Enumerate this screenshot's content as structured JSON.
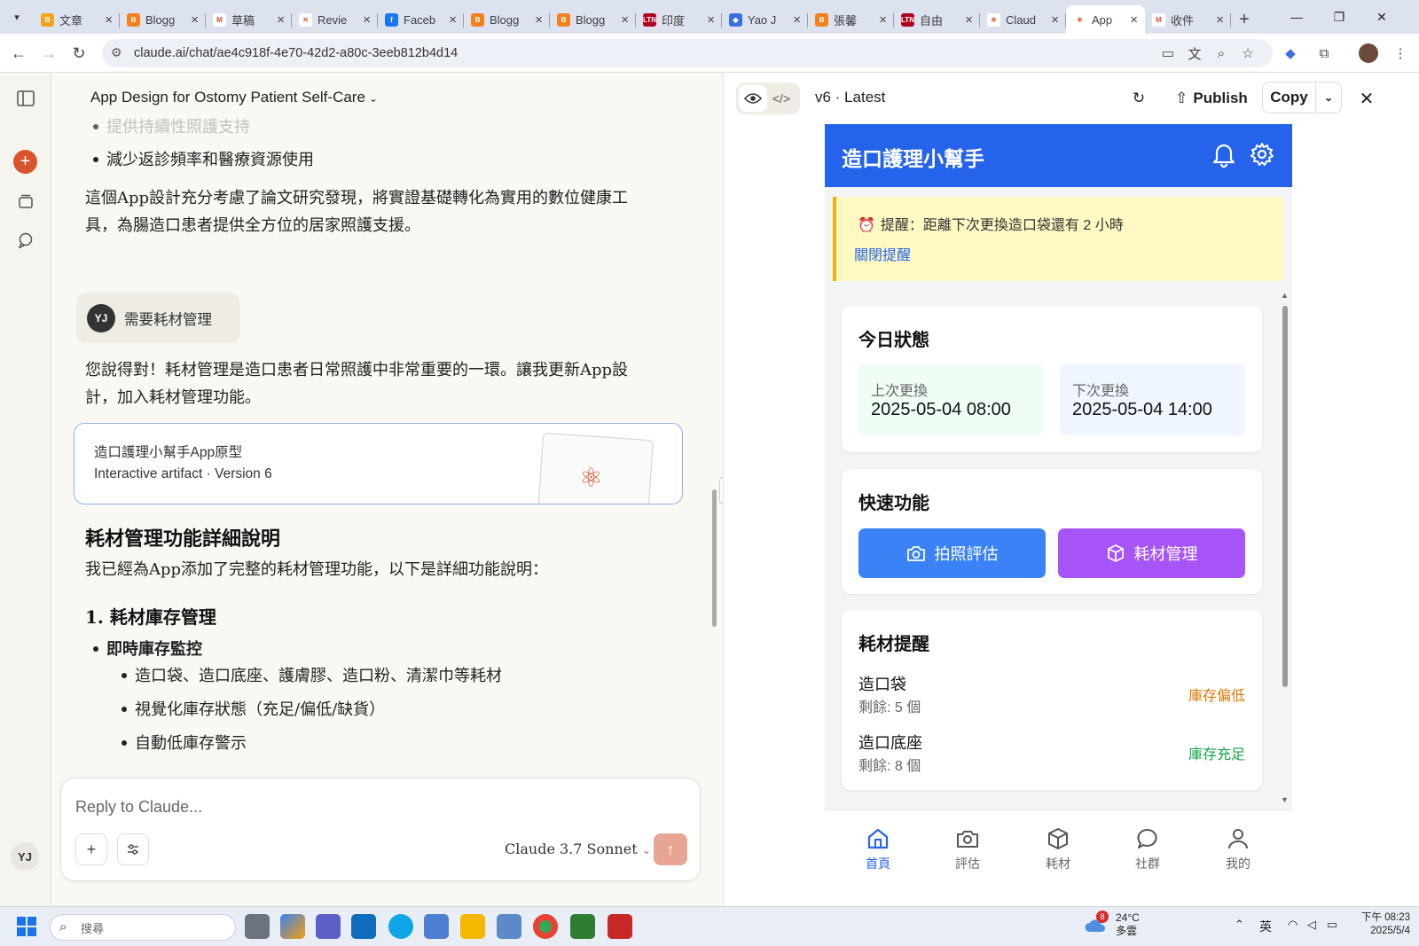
{
  "browser": {
    "tabs": [
      {
        "label": "文章",
        "fav_color": "#f4a31c",
        "fav_glyph": "B"
      },
      {
        "label": "Blogg",
        "fav_color": "#f4801c",
        "fav_glyph": "B"
      },
      {
        "label": "草稿",
        "fav_color": "#ffffff",
        "fav_glyph": "M"
      },
      {
        "label": "Revie",
        "fav_color": "#ffffff",
        "fav_glyph": "✕"
      },
      {
        "label": "Faceb",
        "fav_color": "#1877f2",
        "fav_glyph": "f"
      },
      {
        "label": "Blogg",
        "fav_color": "#f4801c",
        "fav_glyph": "B"
      },
      {
        "label": "Blogg",
        "fav_color": "#f4801c",
        "fav_glyph": "B"
      },
      {
        "label": "印度",
        "fav_color": "#b00020",
        "fav_glyph": "LTN"
      },
      {
        "label": "Yao J",
        "fav_color": "#3b6fe0",
        "fav_glyph": "◆"
      },
      {
        "label": "張馨",
        "fav_color": "#f4801c",
        "fav_glyph": "B"
      },
      {
        "label": "自由",
        "fav_color": "#b00020",
        "fav_glyph": "LTN"
      },
      {
        "label": "Claud",
        "fav_color": "#ffffff",
        "fav_glyph": "✳"
      },
      {
        "label": "App",
        "fav_color": "#ffffff",
        "fav_glyph": "✳",
        "active": true
      },
      {
        "label": "收件",
        "fav_color": "#ffffff",
        "fav_glyph": "M"
      }
    ],
    "url": "claude.ai/chat/ae4c918f-4e70-42d2-a80c-3eeb812b4d14"
  },
  "chat": {
    "title": "App Design for Ostomy Patient Self-Care",
    "faded_bullet": "提供持續性照護支持",
    "bullet_top": "減少返診頻率和醫療資源使用",
    "para1_l1": "這個App設計充分考慮了論文研究發現，將實證基礎轉化為實用的數位健康工",
    "para1_l2": "具，為腸造口患者提供全方位的居家照護支援。",
    "user_initials": "YJ",
    "user_message": "需要耗材管理",
    "reply_l1": "您說得對！耗材管理是造口患者日常照護中非常重要的一環。讓我更新App設",
    "reply_l2": "計，加入耗材管理功能。",
    "artifact_title": "造口護理小幫手App原型",
    "artifact_meta": "Interactive artifact · Version 6",
    "section_title": "耗材管理功能詳細說明",
    "section_intro": "我已經為App添加了完整的耗材管理功能，以下是詳細功能說明：",
    "sub_title": "1. 耗材庫存管理",
    "sub_bullet": "即時庫存監控",
    "sub_items": [
      "造口袋、造口底座、護膚膠、造口粉、清潔巾等耗材",
      "視覺化庫存狀態（充足/偏低/缺貨）",
      "自動低庫存警示"
    ],
    "composer_placeholder": "Reply to Claude...",
    "model_label": "Claude 3.7 Sonnet"
  },
  "panel": {
    "version": "v6 · Latest",
    "publish": "Publish",
    "copy": "Copy"
  },
  "app": {
    "title": "造口護理小幫手",
    "reminder": "提醒：距離下次更換造口袋還有 2 小時",
    "close_reminder": "關閉提醒",
    "today_title": "今日狀態",
    "last_label": "上次更換",
    "last_value": "2025-05-04 08:00",
    "next_label": "下次更換",
    "next_value": "2025-05-04 14:00",
    "quick_title": "快速功能",
    "btn_photo": "拍照評估",
    "btn_supply": "耗材管理",
    "supply_title": "耗材提醒",
    "supplies": [
      {
        "name": "造口袋",
        "remain": "剩餘: 5 個",
        "status": "庫存偏低",
        "color": "#d97706"
      },
      {
        "name": "造口底座",
        "remain": "剩餘: 8 個",
        "status": "庫存充足",
        "color": "#16a34a"
      }
    ],
    "nav": [
      "首頁",
      "評估",
      "耗材",
      "社群",
      "我的"
    ],
    "colors": {
      "primary": "#2563eb",
      "quick_blue": "#3b82f6",
      "quick_purple": "#a855f7"
    }
  },
  "taskbar": {
    "search": "搜尋",
    "weather_temp": "24°C",
    "weather_desc": "多雲",
    "weather_badge": "8",
    "ime": "英",
    "time": "下午 08:23",
    "date": "2025/5/4"
  }
}
